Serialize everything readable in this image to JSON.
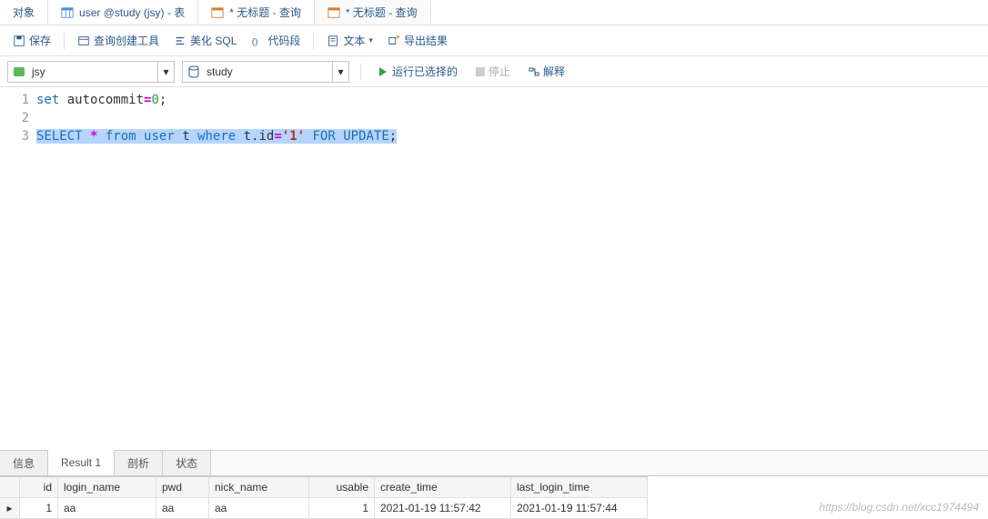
{
  "tabs": {
    "objects": "对象",
    "t1": "user @study (jsy) - 表",
    "t2": "* 无标题 - 查询",
    "t3": "* 无标题 - 查询"
  },
  "toolbar": {
    "save": "保存",
    "queryBuilder": "查询创建工具",
    "beautify": "美化 SQL",
    "snippet": "代码段",
    "text": "文本",
    "export": "导出结果"
  },
  "combos": {
    "conn": "jsy",
    "db": "study"
  },
  "run": {
    "runSel": "运行已选择的",
    "stop": "停止",
    "explain": "解释"
  },
  "editor": {
    "lines": [
      "1",
      "2",
      "3"
    ],
    "l1a": "set ",
    "l1b": "autocommit",
    "l1c": "=",
    "l1d": "0",
    "l1e": ";",
    "l3a": "SELECT",
    "l3b": " * ",
    "l3c": "from ",
    "l3d": "user ",
    "l3e": "t ",
    "l3f": "where ",
    "l3g": "t.id",
    "l3h": "=",
    "l3i": "'1'",
    "l3j": " FOR UPDATE",
    "l3k": ";"
  },
  "btabs": {
    "info": "信息",
    "result": "Result 1",
    "profile": "剖析",
    "status": "状态"
  },
  "grid": {
    "cols": {
      "id": "id",
      "login": "login_name",
      "pwd": "pwd",
      "nick": "nick_name",
      "usable": "usable",
      "create": "create_time",
      "last": "last_login_time"
    },
    "row": {
      "id": "1",
      "login": "aa",
      "pwd": "aa",
      "nick": "aa",
      "usable": "1",
      "create": "2021-01-19 11:57:42",
      "last": "2021-01-19 11:57:44"
    }
  },
  "watermark": "https://blog.csdn.net/xcc1974494"
}
